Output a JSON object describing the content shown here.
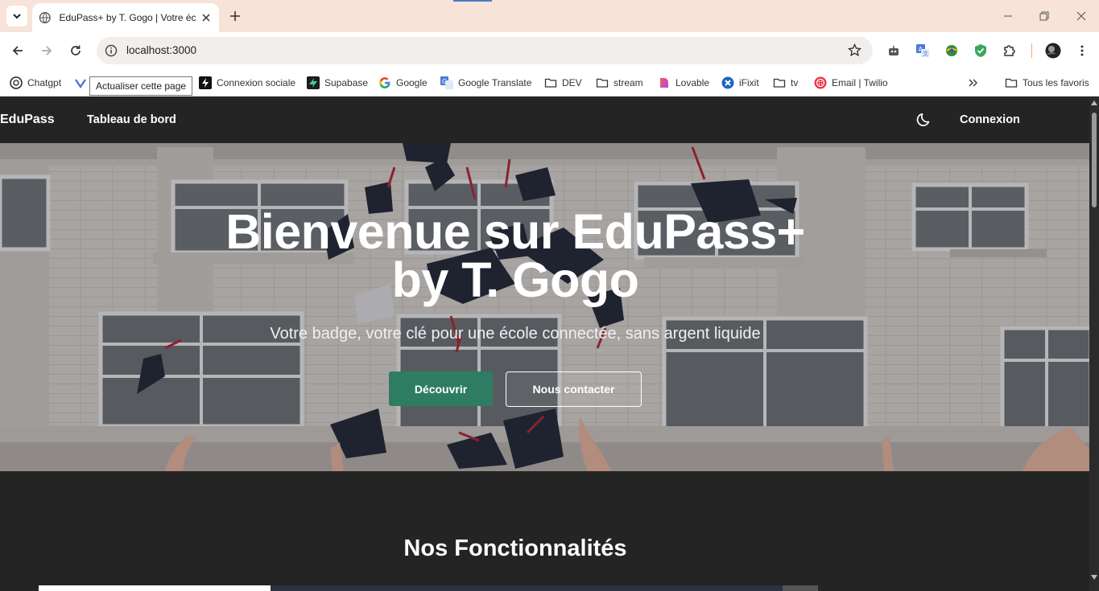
{
  "browser": {
    "tab_title": "EduPass+ by T. Gogo | Votre éc",
    "url": "localhost:3000",
    "tooltip": "Actualiser cette page",
    "bookmarks": [
      {
        "label": "Chatgpt",
        "icon": "chatgpt-icon"
      },
      {
        "label": "Connexion sociale",
        "icon": "bolt-icon"
      },
      {
        "label": "Supabase",
        "icon": "supabase-icon"
      },
      {
        "label": "Google",
        "icon": "google-icon"
      },
      {
        "label": "Google Translate",
        "icon": "translate-icon"
      },
      {
        "label": "DEV",
        "icon": "folder-icon"
      },
      {
        "label": "stream",
        "icon": "folder-icon"
      },
      {
        "label": "Lovable",
        "icon": "lovable-icon"
      },
      {
        "label": "iFixit",
        "icon": "ifixit-icon"
      },
      {
        "label": "tv",
        "icon": "folder-icon"
      },
      {
        "label": "Email | Twilio",
        "icon": "twilio-icon"
      }
    ],
    "all_bookmarks": "Tous les favoris"
  },
  "nav": {
    "brand": "EduPass",
    "dashboard": "Tableau de bord",
    "login": "Connexion"
  },
  "hero": {
    "title_line1": "Bienvenue sur EduPass+",
    "title_line2": "by T. Gogo",
    "subtitle": "Votre badge, votre clé pour une école connectée, sans argent liquide",
    "primary_button": "Découvrir",
    "secondary_button": "Nous contacter"
  },
  "features": {
    "title": "Nos Fonctionnalités"
  },
  "colors": {
    "accent": "#2e7d63",
    "page_bg": "#242424",
    "tabstrip_bg": "#f7e3d8"
  }
}
